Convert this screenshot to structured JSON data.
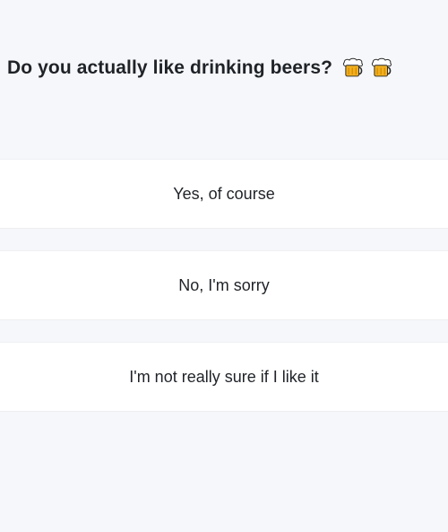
{
  "question": {
    "text": "Do you actually like drinking beers?",
    "emojis": [
      "beer-mug-icon",
      "beer-mug-icon"
    ]
  },
  "answers": [
    {
      "label": "Yes, of course"
    },
    {
      "label": "No, I'm sorry"
    },
    {
      "label": "I'm not really sure if I like it"
    }
  ],
  "colors": {
    "background": "#f6f7fa",
    "card": "#ffffff",
    "text": "#1f2328",
    "beer": "#f2b01e",
    "foam": "#ffffff"
  }
}
